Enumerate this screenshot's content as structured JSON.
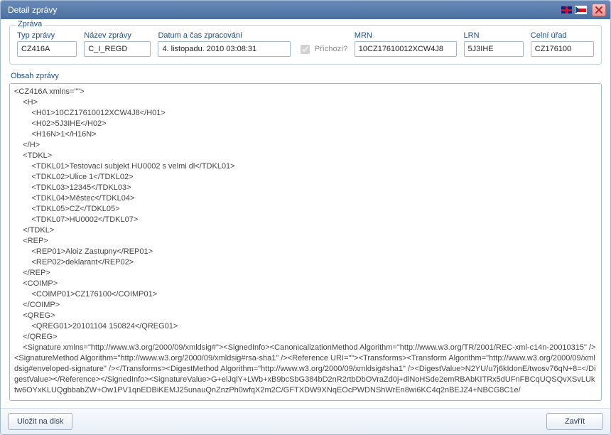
{
  "window": {
    "title": "Detail zprávy"
  },
  "fieldset": {
    "legend": "Zpráva"
  },
  "fields": {
    "typ_zpravy": {
      "label": "Typ zprávy",
      "value": "CZ416A"
    },
    "nazev_zpravy": {
      "label": "Název zprávy",
      "value": "C_I_REGD"
    },
    "datum": {
      "label": "Datum a čas zpracování",
      "value": "4. listopadu. 2010 03:08:31"
    },
    "prichozi": {
      "label": "Příchozí?",
      "checked": true
    },
    "mrn": {
      "label": "MRN",
      "value": "10CZ17610012XCW4J8"
    },
    "lrn": {
      "label": "LRN",
      "value": "5J3IHE"
    },
    "celni_urad": {
      "label": "Celní úřad",
      "value": "CZ176100"
    }
  },
  "content": {
    "label": "Obsah zprávy",
    "body": "<CZ416A xmlns=\"\">\n    <H>\n        <H01>10CZ17610012XCW4J8</H01>\n        <H02>5J3IHE</H02>\n        <H16N>1</H16N>\n    </H>\n    <TDKL>\n        <TDKL01>Testovací subjekt HU0002 s velmi dl</TDKL01>\n        <TDKL02>Ulice 1</TDKL02>\n        <TDKL03>12345</TDKL03>\n        <TDKL04>Městec</TDKL04>\n        <TDKL05>CZ</TDKL05>\n        <TDKL07>HU0002</TDKL07>\n    </TDKL>\n    <REP>\n        <REP01>Aloiz Zastupny</REP01>\n        <REP02>deklarant</REP02>\n    </REP>\n    <COIMP>\n        <COIMP01>CZ176100</COIMP01>\n    </COIMP>\n    <QREG>\n        <QREG01>20101104 150824</QREG01>\n    </QREG>\n    <Signature xmlns=\"http://www.w3.org/2000/09/xmldsig#\"><SignedInfo><CanonicalizationMethod Algorithm=\"http://www.w3.org/TR/2001/REC-xml-c14n-20010315\" /><SignatureMethod Algorithm=\"http://www.w3.org/2000/09/xmldsig#rsa-sha1\" /><Reference URI=\"\"><Transforms><Transform Algorithm=\"http://www.w3.org/2000/09/xmldsig#enveloped-signature\" /></Transforms><DigestMethod Algorithm=\"http://www.w3.org/2000/09/xmldsig#sha1\" /><DigestValue>N2YU/u7j6kIdonE/twosv76qN+8=</DigestValue></Reference></SignedInfo><SignatureValue>G+elJqlY+LWb+xB9bcSbG384bD2nR2rtbDbOVraZd0j+dlNoHSde2emRBAbKITRx5dUFnFBCqUQSQvXSvLUktw6OYxKLUQgbbabZW+Ow1PV1qnEDBiKEMJ25unauQnZnzPh0wfqX2m2C/GFTXDW9XNqEOcPWDNShWrEn8wi6KC4q2nBEJZ4+NBCG8C1e/"
  },
  "footer": {
    "save_label": "Uložit na disk",
    "close_label": "Zavřít"
  }
}
